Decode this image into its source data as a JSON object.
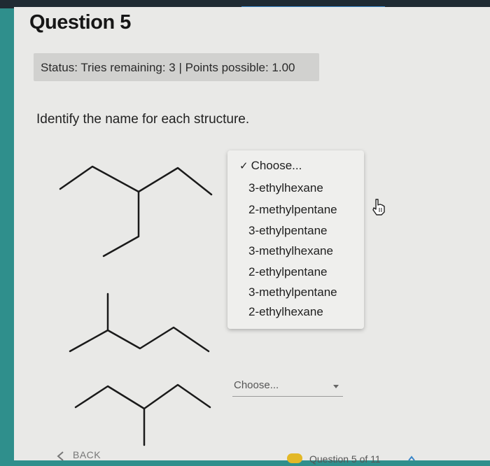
{
  "question": {
    "title": "Question 5",
    "status": "Status: Tries remaining: 3 | Points possible: 1.00",
    "prompt": "Identify the name for each structure."
  },
  "dropdown": {
    "selected_option": "Choose...",
    "options": [
      "3-ethylhexane",
      "2-methylpentane",
      "3-ethylpentane",
      "3-methylhexane",
      "2-ethylpentane",
      "3-methylpentane",
      "2-ethylhexane"
    ]
  },
  "answer_select": {
    "placeholder": "Choose..."
  },
  "footer": {
    "back_label": "BACK",
    "progress_text": "Question 5 of 11",
    "progress_color": "#e3b826"
  },
  "colors": {
    "background": "#2f8f8c",
    "page": "#e9e9e7",
    "status_box": "#d1d1cf"
  }
}
